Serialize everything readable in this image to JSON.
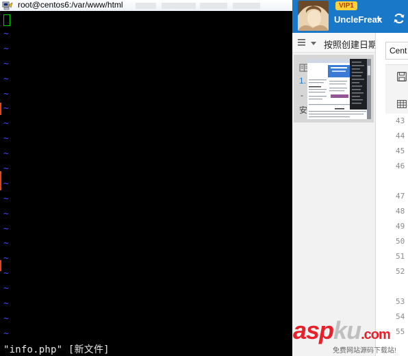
{
  "terminal": {
    "title": "root@centos6:/var/www/html",
    "tilde_char": "~",
    "tilde_count": 21,
    "status_line": "\"info.php\" [新文件]"
  },
  "app": {
    "vip_label": "VIP1",
    "username": "UncleFreak",
    "sort_label": "按照创建日期",
    "note_index": "1.",
    "note_dash": "-",
    "note_char": "安",
    "doc_tab": "Cent",
    "line_numbers": [
      {
        "n": "43",
        "top": 0
      },
      {
        "n": "44"
      },
      {
        "n": "45"
      },
      {
        "n": "46"
      },
      {
        "n": "47"
      },
      {
        "n": "48"
      },
      {
        "n": "49"
      },
      {
        "n": "50"
      },
      {
        "n": "51"
      },
      {
        "n": "52"
      },
      {
        "n": "53"
      },
      {
        "n": "54"
      },
      {
        "n": "55"
      }
    ]
  },
  "watermark": {
    "brand_red": "asp",
    "brand_gray": "ku",
    "brand_tld": ".com",
    "subtitle": "免费网站源码下载站!"
  },
  "colors": {
    "terminal_bg": "#000000",
    "tilde": "#4848ff",
    "cursor": "#00d000",
    "app_header": "#1a78c8",
    "watermark_red": "#e8202a"
  }
}
